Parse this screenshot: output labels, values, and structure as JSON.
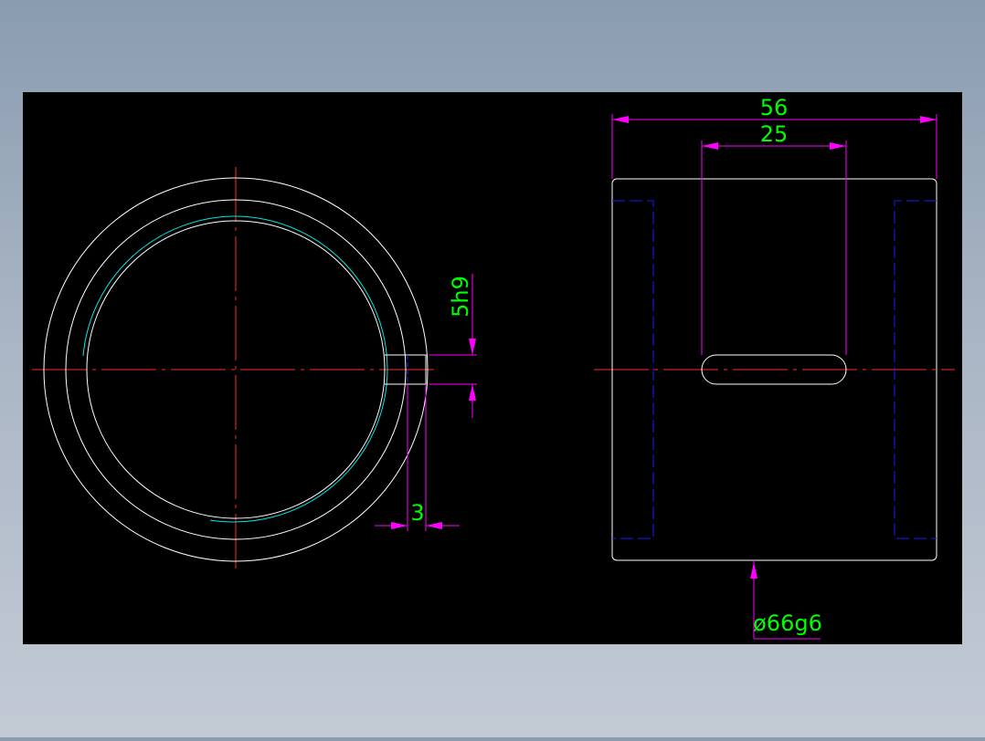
{
  "drawing": {
    "colors": {
      "background": "#000000",
      "outline": "#ffffff",
      "centerline": "#ff2a2a",
      "dimension": "#ff00ff",
      "dimension_text": "#00ff00",
      "hidden": "#1a1aff",
      "thread": "#00e5e5"
    },
    "dimensions": {
      "overall_length": "56",
      "slot_length": "25",
      "keyway_width": "5h9",
      "keyway_depth": "3",
      "outer_diameter": "ø66g6"
    }
  }
}
